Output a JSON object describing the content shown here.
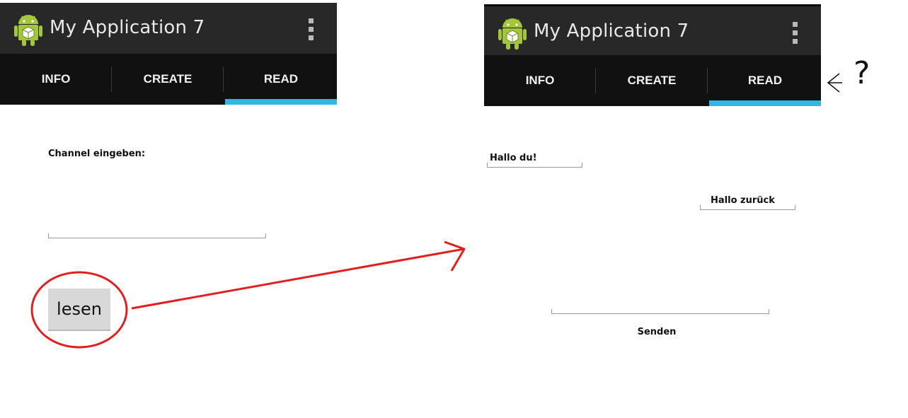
{
  "left_screen": {
    "app_title": "My Application 7",
    "tabs": [
      {
        "label": "INFO"
      },
      {
        "label": "CREATE"
      },
      {
        "label": "READ"
      }
    ],
    "active_tab": "READ",
    "channel_label": "Channel eingeben:",
    "channel_value": "",
    "read_button_label": "lesen"
  },
  "right_screen": {
    "app_title": "My Application 7",
    "tabs": [
      {
        "label": "INFO"
      },
      {
        "label": "CREATE"
      },
      {
        "label": "READ"
      }
    ],
    "active_tab": "READ",
    "message_1": "Hallo du!",
    "message_2": "Hallo zurück",
    "send_button_label": "Senden"
  },
  "annotations": {
    "question_mark": "?",
    "annotation_color": "#e02020"
  },
  "colors": {
    "action_bar": "#282828",
    "tab_bar": "#111111",
    "tab_indicator": "#33b5e5",
    "android_green": "#a4c639"
  },
  "icons": [
    "android-logo-icon",
    "overflow-menu-icon"
  ]
}
